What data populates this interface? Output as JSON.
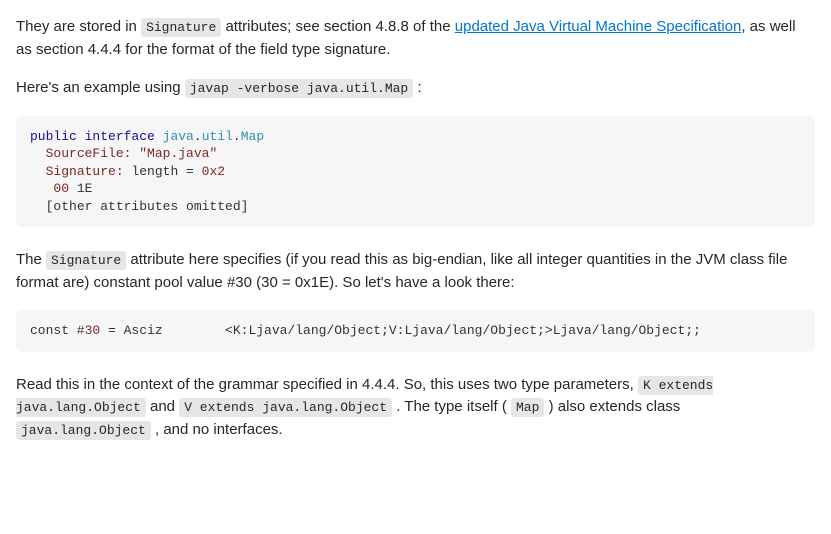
{
  "para1": {
    "t1": "They are stored in ",
    "code1": "Signature",
    "t2": " attributes; see section 4.8.8 of the ",
    "link_text": "updated Java Virtual Machine Specification",
    "t3": ", as well as section 4.4.4 for the format of the field type signature."
  },
  "para2": {
    "t1": "Here's an example using ",
    "code1": "javap -verbose java.util.Map",
    "t2": " :"
  },
  "code1": {
    "l1_kw1": "public",
    "l1_kw2": "interface",
    "l1_pkg1": "java",
    "l1_dot1": ".",
    "l1_pkg2": "util",
    "l1_dot2": ".",
    "l1_cls": "Map",
    "l2_label": "  SourceFile: ",
    "l2_str": "\"Map.java\"",
    "l3_label": "  Signature: ",
    "l3_rest": "length = ",
    "l3_hex": "0x2",
    "l4_num": "   00",
    "l4_rest": " 1E",
    "l5": "  [other attributes omitted]"
  },
  "para3": {
    "t1": "The ",
    "code1": "Signature",
    "t2": " attribute here specifies (if you read this as big-endian, like all integer quantities in the JVM class file format are) constant pool value #30 (30 = 0x1E). So let's have a look there:"
  },
  "code2": {
    "l1_a": "const #",
    "l1_num": "30",
    "l1_b": " = Asciz        <K:Ljava/lang/Object;V:Ljava/lang/Object;>Ljava/lang/Object;;"
  },
  "para4": {
    "t1": "Read this in the context of the grammar specified in 4.4.4. So, this uses two type parameters, ",
    "code1": "K extends java.lang.Object",
    "t2": " and ",
    "code2": "V extends java.lang.Object",
    "t3": " . The type itself ( ",
    "code3": "Map",
    "t4": " ) also extends class ",
    "code4": "java.lang.Object",
    "t5": " , and no interfaces."
  }
}
